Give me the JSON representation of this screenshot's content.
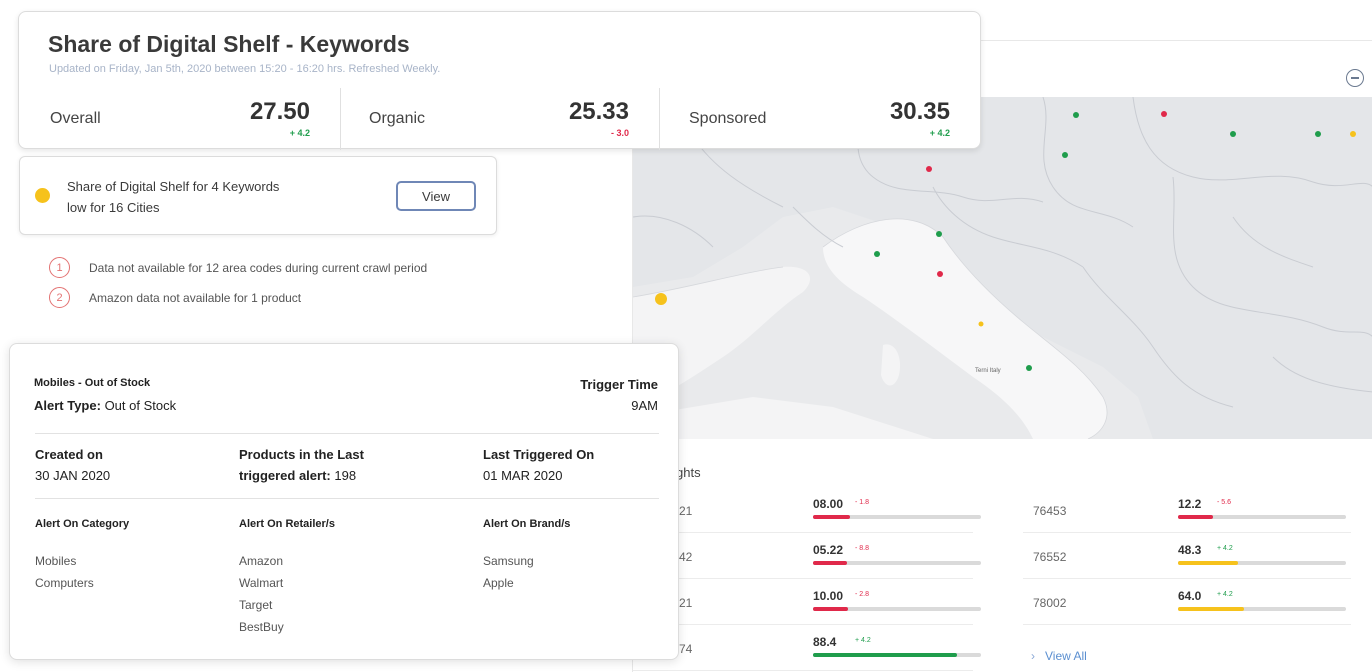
{
  "shelf_card": {
    "title": "Share of Digital Shelf - Keywords",
    "subtitle": "Updated on Friday, Jan 5th, 2020 between 15:20 - 16:20 hrs. Refreshed Weekly.",
    "metrics": [
      {
        "label": "Overall",
        "value": "27.50",
        "delta": "+ 4.2",
        "trend": "up"
      },
      {
        "label": "Organic",
        "value": "25.33",
        "delta": "- 3.0",
        "trend": "down"
      },
      {
        "label": "Sponsored",
        "value": "30.35",
        "delta": "+ 4.2",
        "trend": "up"
      }
    ]
  },
  "alert_strip": {
    "line1": "Share of Digital Shelf for 4 Keywords",
    "line2": "low for 16 Cities",
    "view_label": "View",
    "dot_color": "#f6c21c"
  },
  "notes": [
    {
      "num": "1",
      "text": "Data not available for 12 area codes during current crawl period"
    },
    {
      "num": "2",
      "text": "Amazon data not available for 1 product"
    }
  ],
  "alert_detail": {
    "name": "Mobiles - Out of Stock",
    "type_label": "Alert Type:",
    "type_value": "Out of Stock",
    "trigger_label": "Trigger Time",
    "trigger_value": "9AM",
    "created_label": "Created on",
    "created_value": "30 JAN 2020",
    "products_label_line1": "Products in the Last",
    "products_label_line2": "triggered alert:",
    "products_value": "198",
    "last_triggered_label": "Last Triggered On",
    "last_triggered_value": "01 MAR 2020",
    "category_label": "Alert On Category",
    "categories": [
      "Mobiles",
      "Computers"
    ],
    "retailer_label": "Alert On Retailer/s",
    "retailers": [
      "Amazon",
      "Walmart",
      "Target",
      "BestBuy"
    ],
    "brand_label": "Alert On Brand/s",
    "brands": [
      "Samsung",
      "Apple"
    ]
  },
  "map": {
    "city_label": "Terni Italy",
    "marker_colors": {
      "good": "#1f9d4c",
      "bad": "#e0294a",
      "warn": "#f6c21c"
    }
  },
  "highlights": {
    "title": "hlights",
    "view_all_label": "View All",
    "left": [
      {
        "code": "21",
        "value": "08.00",
        "delta": "- 1.8",
        "trend": "down",
        "level": 0.22
      },
      {
        "code": "42",
        "value": "05.22",
        "delta": "- 8.8",
        "trend": "down",
        "level": 0.2
      },
      {
        "code": "21",
        "value": "10.00",
        "delta": "- 2.8",
        "trend": "down",
        "level": 0.21
      },
      {
        "code": "74",
        "value": "88.4",
        "delta": "+ 4.2",
        "trend": "up",
        "level": 0.86
      }
    ],
    "right": [
      {
        "code": "76453",
        "value": "12.2",
        "delta": "- 5.6",
        "trend": "down",
        "level": 0.21
      },
      {
        "code": "76552",
        "value": "48.3",
        "delta": "+ 4.2",
        "trend": "up",
        "level": 0.36
      },
      {
        "code": "78002",
        "value": "64.0",
        "delta": "+ 4.2",
        "trend": "up",
        "level": 0.39
      }
    ],
    "colors": {
      "red": "#e0294a",
      "yellow": "#f6c21c",
      "green": "#1f9d4c",
      "track": "#dadada"
    }
  }
}
